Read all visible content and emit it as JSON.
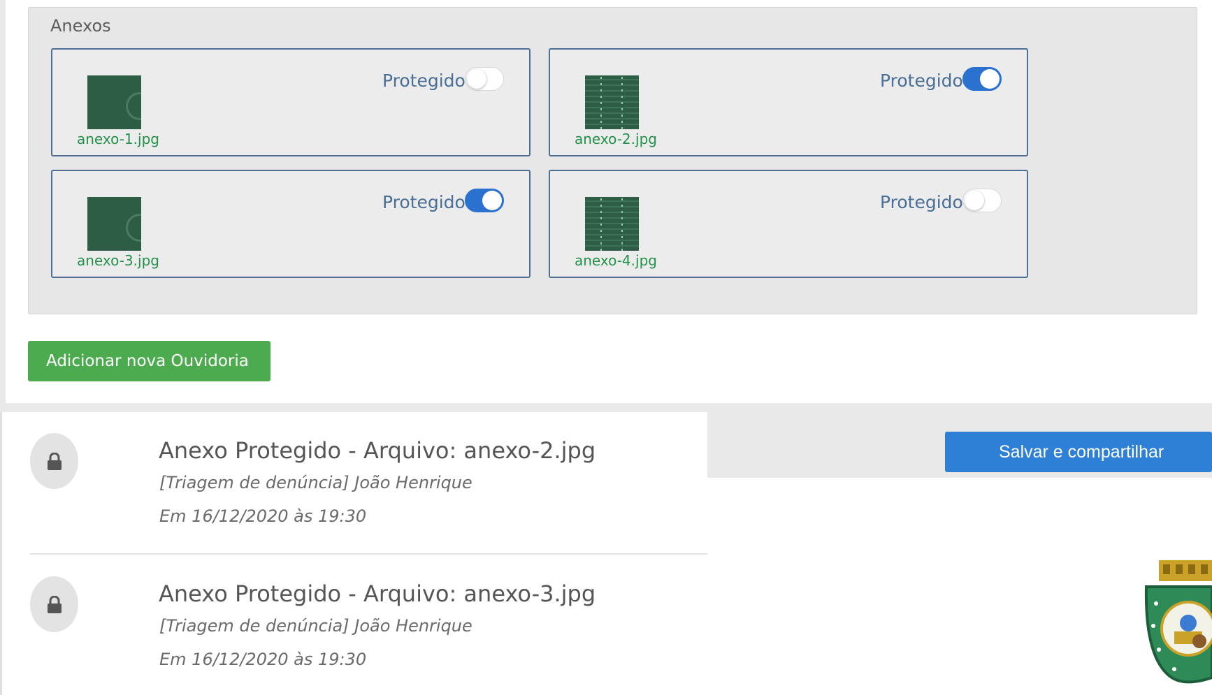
{
  "attachments": {
    "section_title": "Anexos",
    "protected_label": "Protegido",
    "items": [
      {
        "filename": "anexo-1.jpg",
        "protected": false,
        "thumbnail": "image-thumbnail-icon"
      },
      {
        "filename": "anexo-2.jpg",
        "protected": true,
        "thumbnail": "image-thumbnail-icon"
      },
      {
        "filename": "anexo-3.jpg",
        "protected": true,
        "thumbnail": "image-thumbnail-icon"
      },
      {
        "filename": "anexo-4.jpg",
        "protected": false,
        "thumbnail": "image-thumbnail-icon"
      }
    ]
  },
  "actions": {
    "add_button_label": "Adicionar nova Ouvidoria",
    "save_share_label": "Salvar e compartilhar"
  },
  "history": [
    {
      "icon": "lock-icon",
      "title": "Anexo Protegido - Arquivo: anexo-2.jpg",
      "subtitle": "[Triagem de denúncia] João Henrique",
      "date": "Em 16/12/2020 às 19:30"
    },
    {
      "icon": "lock-icon",
      "title": "Anexo Protegido - Arquivo: anexo-3.jpg",
      "subtitle": "[Triagem de denúncia] João Henrique",
      "date": "Em 16/12/2020 às 19:30"
    }
  ],
  "colors": {
    "toggle_on": "#2a71d0",
    "add_button": "#4cab4f",
    "save_button": "#2e80d7",
    "filename_text": "#23914a",
    "card_border": "#4e6f95"
  }
}
